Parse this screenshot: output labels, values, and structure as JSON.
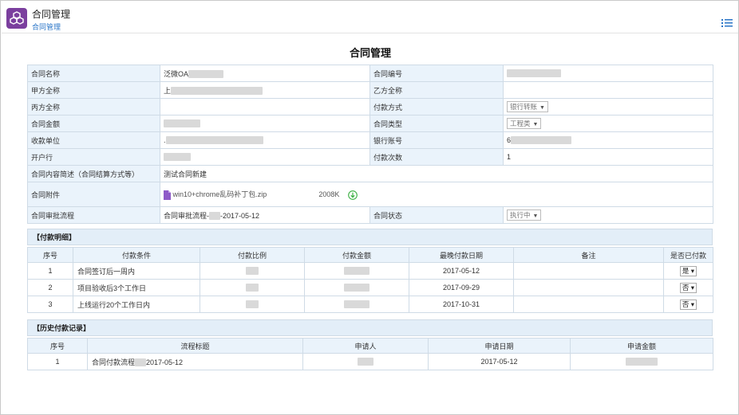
{
  "header": {
    "app_title": "合同管理",
    "breadcrumb": "合同管理",
    "app_icon": "cubes-icon",
    "menu_icon": "list-menu-icon"
  },
  "page": {
    "title": "合同管理"
  },
  "contract": {
    "name_label": "合同名称",
    "name_value": "泛微OA",
    "number_label": "合同编号",
    "party_a_label": "甲方全称",
    "party_a_value": "上",
    "party_b_label": "乙方全称",
    "party_c_label": "丙方全称",
    "pay_method_label": "付款方式",
    "pay_method_value": "银行转账",
    "amount_label": "合同金额",
    "type_label": "合同类型",
    "type_value": "工程类",
    "payee_label": "收款单位",
    "payee_value": ".",
    "account_label": "银行账号",
    "account_value": "6",
    "bank_label": "开户行",
    "pay_count_label": "付款次数",
    "pay_count_value": "1",
    "summary_label": "合同内容简述（合同结算方式等）",
    "summary_value": "测试合同新建",
    "attachment_label": "合同附件",
    "attachment_name": "win10+chrome乱码补丁包.zip",
    "attachment_size": "2008K",
    "flow_label": "合同审批流程",
    "flow_value_prefix": "合同审批流程-",
    "flow_value_suffix": "-2017-05-12",
    "status_label": "合同状态",
    "status_value": "执行中"
  },
  "payment_detail": {
    "title": "【付款明细】",
    "headers": [
      "序号",
      "付款条件",
      "付款比例",
      "付款金额",
      "最晚付款日期",
      "备注",
      "是否已付款"
    ],
    "rows": [
      {
        "no": "1",
        "condition": "合同签订后一周内",
        "date": "2017-05-12",
        "paid": "是"
      },
      {
        "no": "2",
        "condition": "项目验收后3个工作日",
        "date": "2017-09-29",
        "paid": "否"
      },
      {
        "no": "3",
        "condition": "上线运行20个工作日内",
        "date": "2017-10-31",
        "paid": "否"
      }
    ]
  },
  "history": {
    "title": "【历史付款记录】",
    "headers": [
      "序号",
      "流程标题",
      "申请人",
      "申请日期",
      "申请金额"
    ],
    "rows": [
      {
        "no": "1",
        "title_prefix": "合同付款流程",
        "title_suffix": "2017-05-12",
        "date": "2017-05-12"
      }
    ]
  },
  "colors": {
    "accent": "#2a75c7",
    "brand": "#7b3f9e",
    "label_bg": "#eaf3fb",
    "section_bg": "#e3eef8",
    "border": "#cfdbe6",
    "download": "#3cb043"
  }
}
